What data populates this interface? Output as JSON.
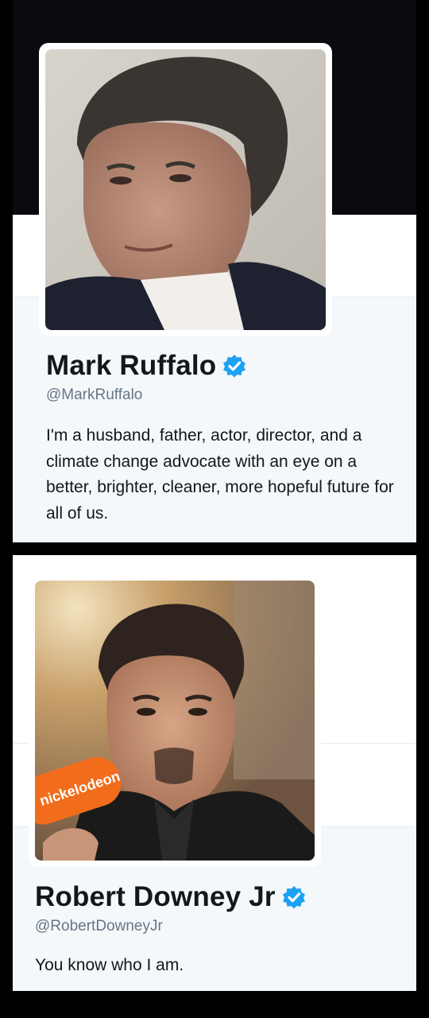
{
  "profiles": [
    {
      "name": "Mark Ruffalo",
      "handle": "@MarkRuffalo",
      "verified": true,
      "bio": "I'm a husband, father, actor, director, and a climate change advocate with an eye on a better, brighter, cleaner, more hopeful future for all of us.",
      "avatar_icon": "profile-photo"
    },
    {
      "name": "Robert Downey Jr",
      "handle": "@RobertDowneyJr",
      "verified": true,
      "bio": "You know who I am.",
      "avatar_icon": "profile-photo",
      "avatar_logo_text": "nickelodeon"
    }
  ],
  "colors": {
    "background": "#000000",
    "card_body": "#f5f8fa",
    "verified_badge": "#1da1f2",
    "name_text": "#14171a",
    "handle_text": "#657786"
  }
}
